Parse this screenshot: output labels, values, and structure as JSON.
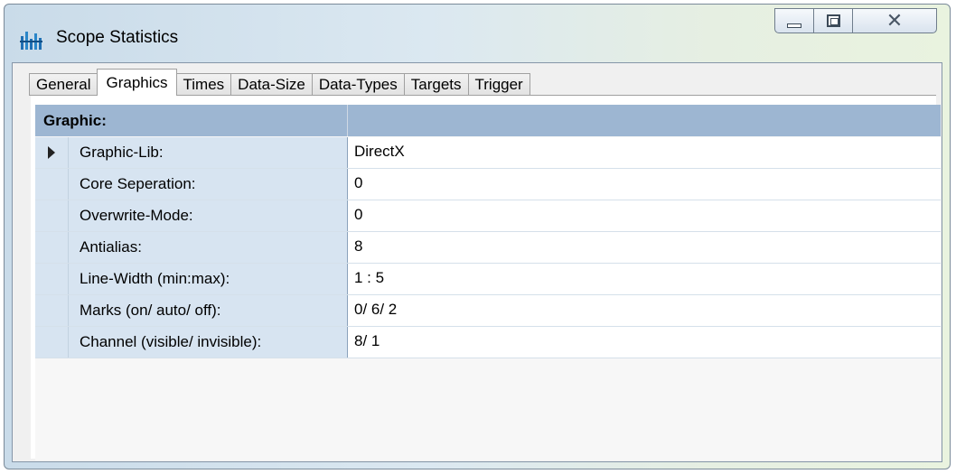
{
  "window": {
    "title": "Scope Statistics",
    "icon": "scope-bars-icon",
    "controls": {
      "minimize": "minimize-icon",
      "maximize": "maximize-icon",
      "close": "close-icon"
    }
  },
  "tabs": [
    {
      "label": "General"
    },
    {
      "label": "Graphics",
      "active": true
    },
    {
      "label": "Times"
    },
    {
      "label": "Data-Size"
    },
    {
      "label": "Data-Types"
    },
    {
      "label": "Targets"
    },
    {
      "label": "Trigger"
    }
  ],
  "grid": {
    "category": "Graphic:",
    "rows": [
      {
        "name": "Graphic-Lib:",
        "value": "DirectX",
        "selected": true
      },
      {
        "name": "Core Seperation:",
        "value": "0"
      },
      {
        "name": "Overwrite-Mode:",
        "value": "0"
      },
      {
        "name": "Antialias:",
        "value": "8"
      },
      {
        "name": "Line-Width (min:max):",
        "value": "1 : 5"
      },
      {
        "name": "Marks (on/ auto/ off):",
        "value": "0/ 6/ 2"
      },
      {
        "name": "Channel (visible/ invisible):",
        "value": "8/ 1"
      }
    ]
  },
  "colors": {
    "category_bg": "#9db6d2",
    "row_header_bg": "#d7e4f1",
    "icon_blue": "#1f6fb3"
  }
}
